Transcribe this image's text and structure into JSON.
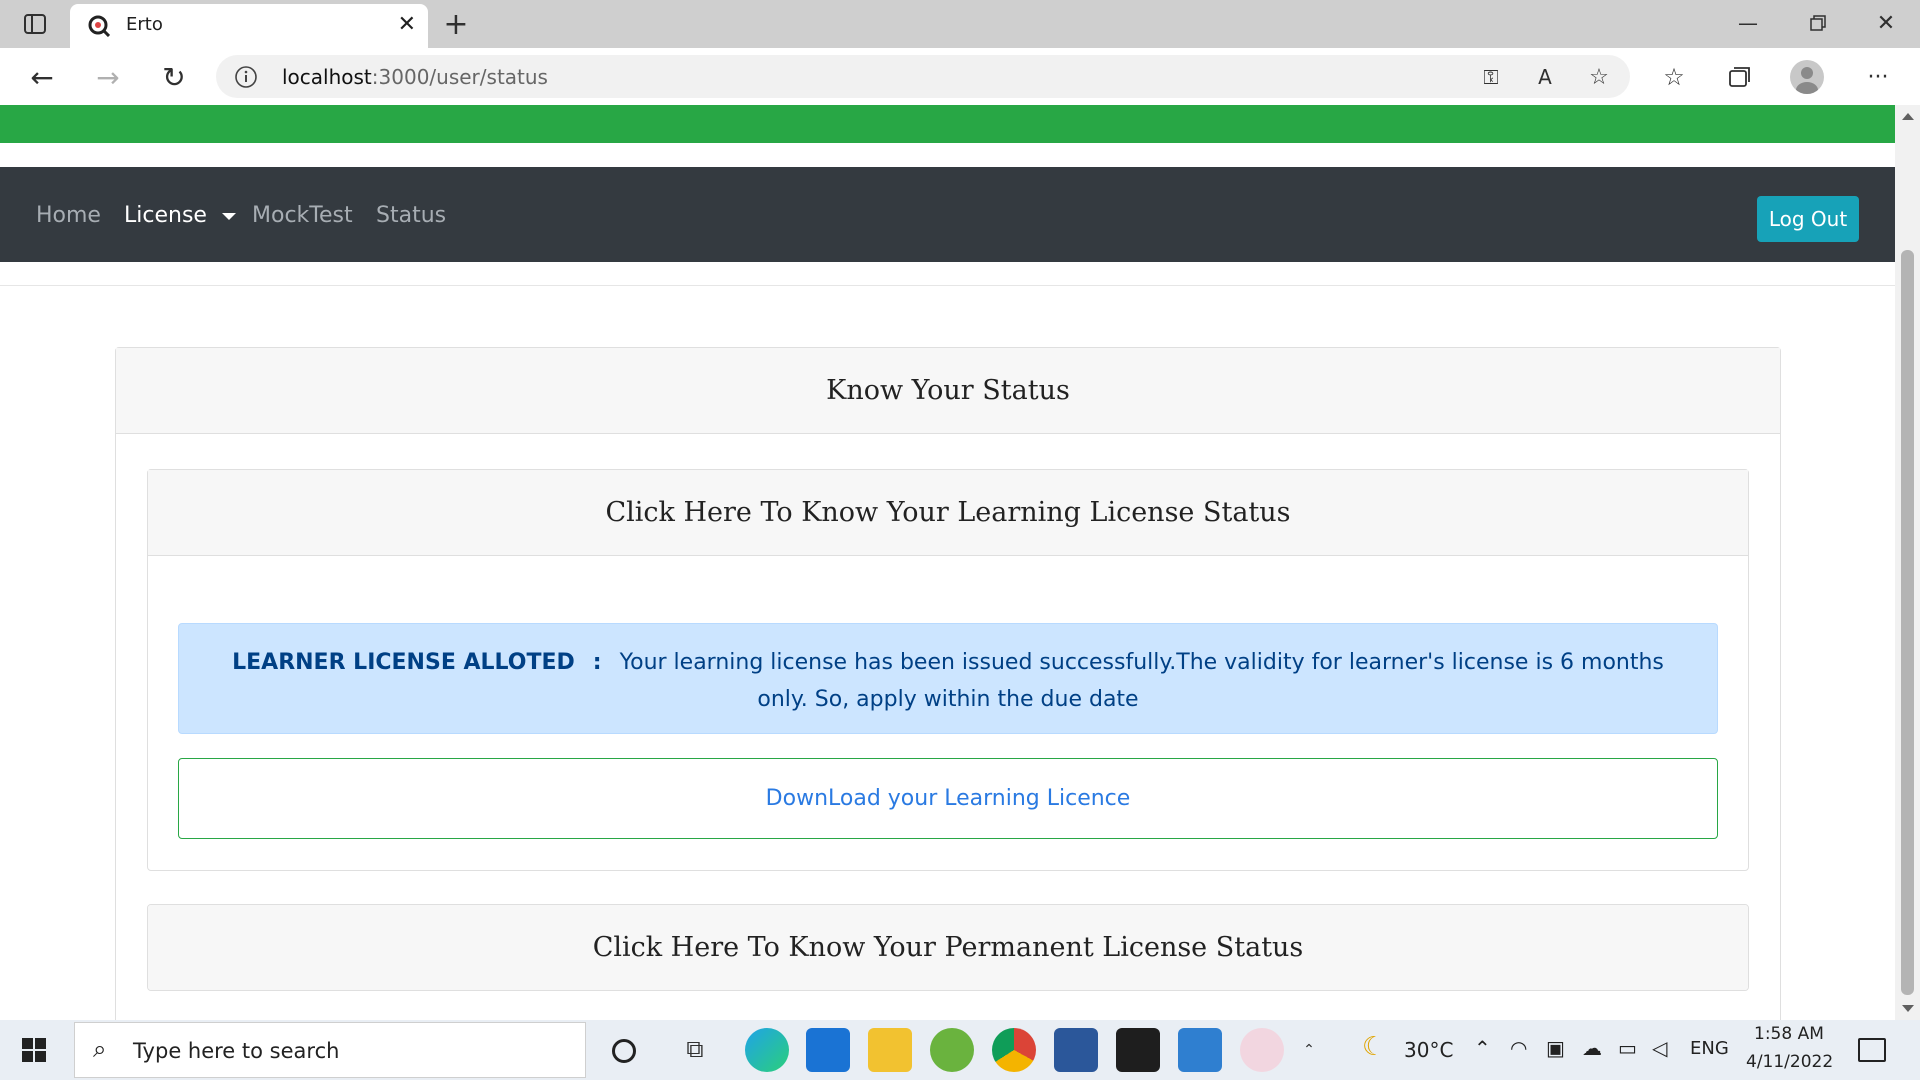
{
  "browser": {
    "tab_title": "Erto",
    "url_host": "localhost",
    "url_path": ":3000/user/status"
  },
  "navbar": {
    "home": "Home",
    "license": "License",
    "mocktest": "MockTest",
    "status": "Status",
    "logout": "Log Out"
  },
  "status_card": {
    "title": "Know Your Status",
    "learning_header": "Click Here To Know Your Learning License Status",
    "alert_label": "LEARNER LICENSE ALLOTED",
    "alert_sep": ":",
    "alert_text": "Your learning license has been issued successfully.The validity for learner's license is 6 months only. So, apply within the due date",
    "download_link": "DownLoad your Learning Licence",
    "permanent_header": "Click Here To Know Your Permanent License Status"
  },
  "taskbar": {
    "search_placeholder": "Type here to search",
    "temperature": "30°C",
    "language": "ENG",
    "time": "1:58 AM",
    "date": "4/11/2022"
  },
  "colors": {
    "banner": "#28a745",
    "navbar": "#343a40",
    "logout_button": "#17a2b8",
    "alert_bg": "#cce5ff",
    "link": "#2a7ae2"
  }
}
